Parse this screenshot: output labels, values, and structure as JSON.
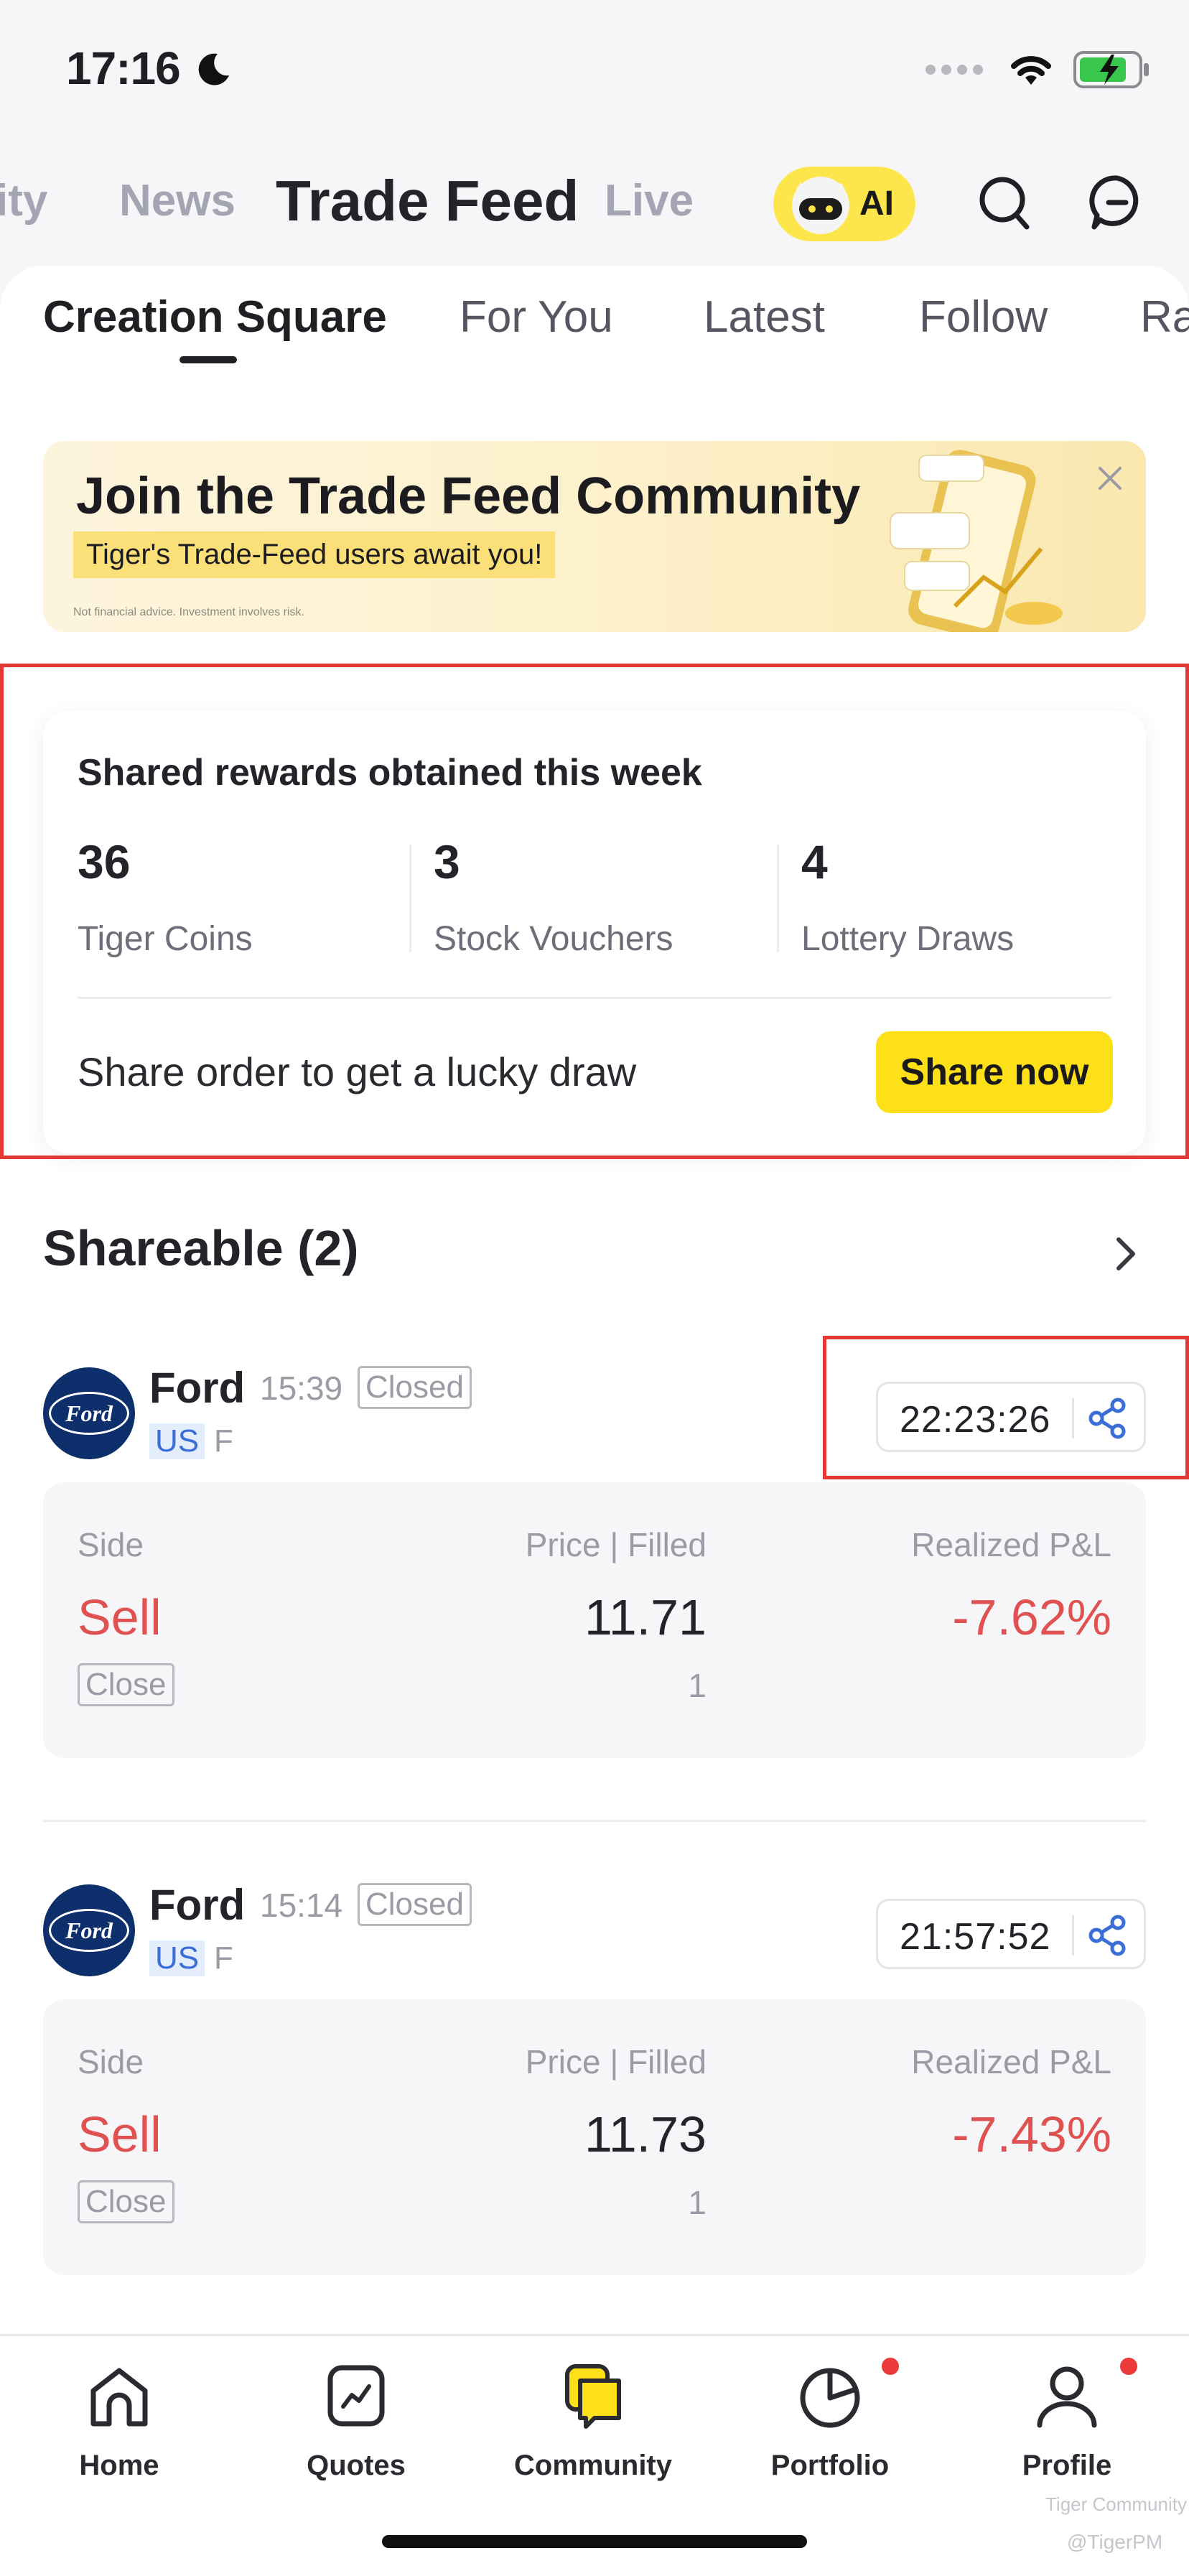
{
  "status_bar": {
    "time": "17:16"
  },
  "top_nav": {
    "tabs": [
      "ity",
      "News",
      "Trade Feed",
      "Live"
    ],
    "ai_label": "AI"
  },
  "sub_tabs": [
    "Creation Square",
    "For You",
    "Latest",
    "Follow",
    "Ra"
  ],
  "banner": {
    "title": "Join the Trade Feed Community",
    "subtitle": "Tiger's Trade-Feed users await you!",
    "disclaimer": "Not financial advice. Investment involves risk."
  },
  "rewards": {
    "heading": "Shared rewards obtained this week",
    "stats": [
      {
        "value": "36",
        "label": "Tiger Coins"
      },
      {
        "value": "3",
        "label": "Stock Vouchers"
      },
      {
        "value": "4",
        "label": "Lottery Draws"
      }
    ],
    "share_text": "Share order to get a lucky draw",
    "share_button": "Share now"
  },
  "shareable": {
    "title": "Shareable (2)",
    "headers": {
      "side": "Side",
      "price": "Price",
      "filled": "Filled",
      "pnl": "Realized P&L"
    },
    "orders": [
      {
        "name": "Ford",
        "time": "15:39",
        "status": "Closed",
        "market": "US",
        "ticker": "F",
        "countdown": "22:23:26",
        "side": "Sell",
        "tag": "Close",
        "price": "11.71",
        "filled": "1",
        "pnl": "-7.62%"
      },
      {
        "name": "Ford",
        "time": "15:14",
        "status": "Closed",
        "market": "US",
        "ticker": "F",
        "countdown": "21:57:52",
        "side": "Sell",
        "tag": "Close",
        "price": "11.73",
        "filled": "1",
        "pnl": "-7.43%"
      }
    ]
  },
  "bottom_nav": {
    "items": [
      {
        "label": "Home",
        "icon": "home-icon"
      },
      {
        "label": "Quotes",
        "icon": "quotes-icon"
      },
      {
        "label": "Community",
        "icon": "community-icon"
      },
      {
        "label": "Portfolio",
        "icon": "portfolio-icon"
      },
      {
        "label": "Profile",
        "icon": "profile-icon"
      }
    ]
  },
  "watermark": {
    "line1": "Tiger Community",
    "line2": "@TigerPM"
  },
  "colors": {
    "accent_yellow": "#fde018",
    "loss_red": "#e05252",
    "market_blue": "#3b6fd6",
    "highlight_red": "#e53935"
  }
}
